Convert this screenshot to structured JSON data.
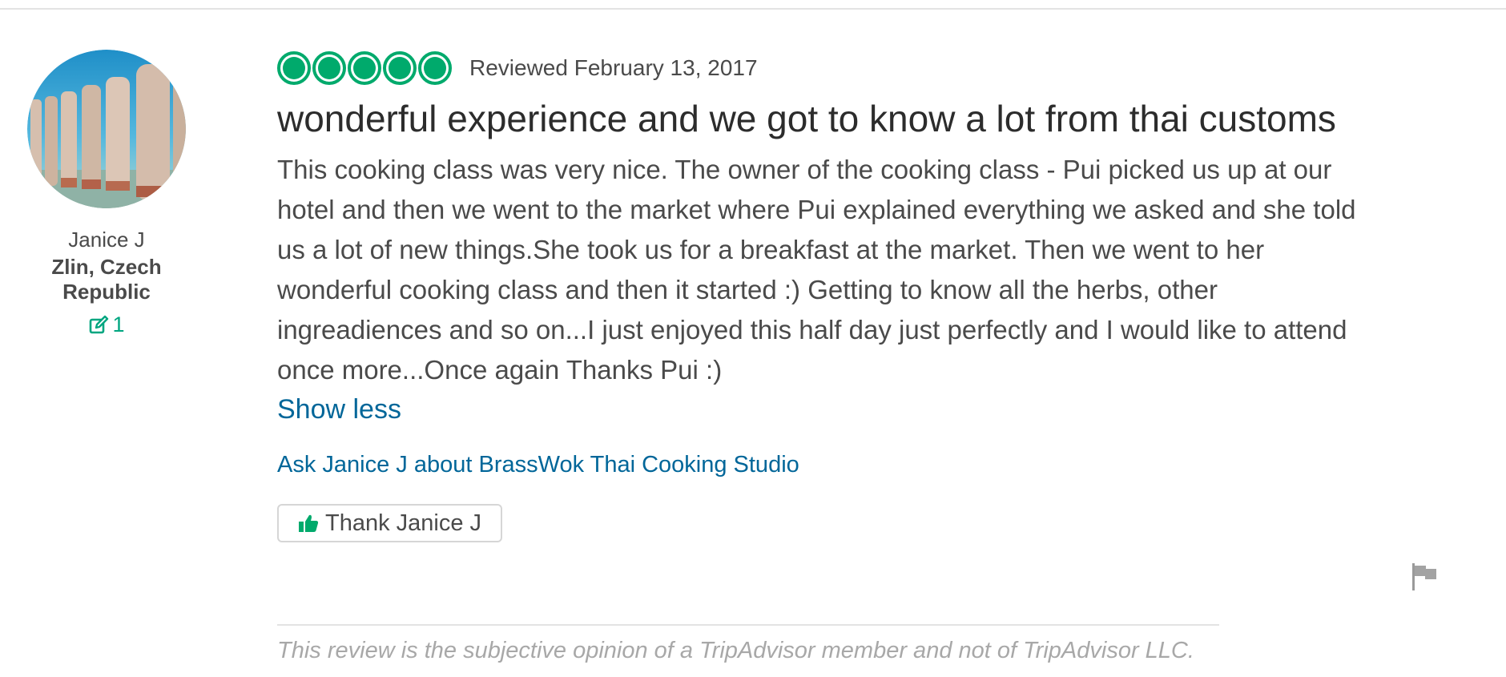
{
  "reviewer": {
    "name": "Janice J",
    "location": "Zlin, Czech Republic",
    "contributions": "1"
  },
  "review": {
    "rating": 5,
    "date": "Reviewed February 13, 2017",
    "title": "wonderful experience and we got to know a lot from thai customs",
    "body": "This cooking class was very nice. The owner of the cooking class - Pui picked us up at our hotel and then we went to the market where Pui explained everything we asked and she told us a lot of new things.She took us for a breakfast at the market. Then we went to her wonderful cooking class and then it started :) Getting to know all the herbs, other ingreadiences and so on...I just enjoyed this half day just perfectly and I would like to attend once more...Once again Thanks Pui :)",
    "show_less": "Show less",
    "ask_link": "Ask Janice J about BrassWok Thai Cooking Studio",
    "thank_label": "Thank Janice J",
    "disclaimer": "This review is the subjective opinion of a TripAdvisor member and not of TripAdvisor LLC."
  },
  "icons": {
    "contributions": "pencil-edit-icon",
    "thank": "thumbs-up-icon",
    "report": "flag-icon"
  },
  "colors": {
    "accent_green": "#00aa6c",
    "link_blue": "#006699",
    "text": "#4a4a4a"
  }
}
